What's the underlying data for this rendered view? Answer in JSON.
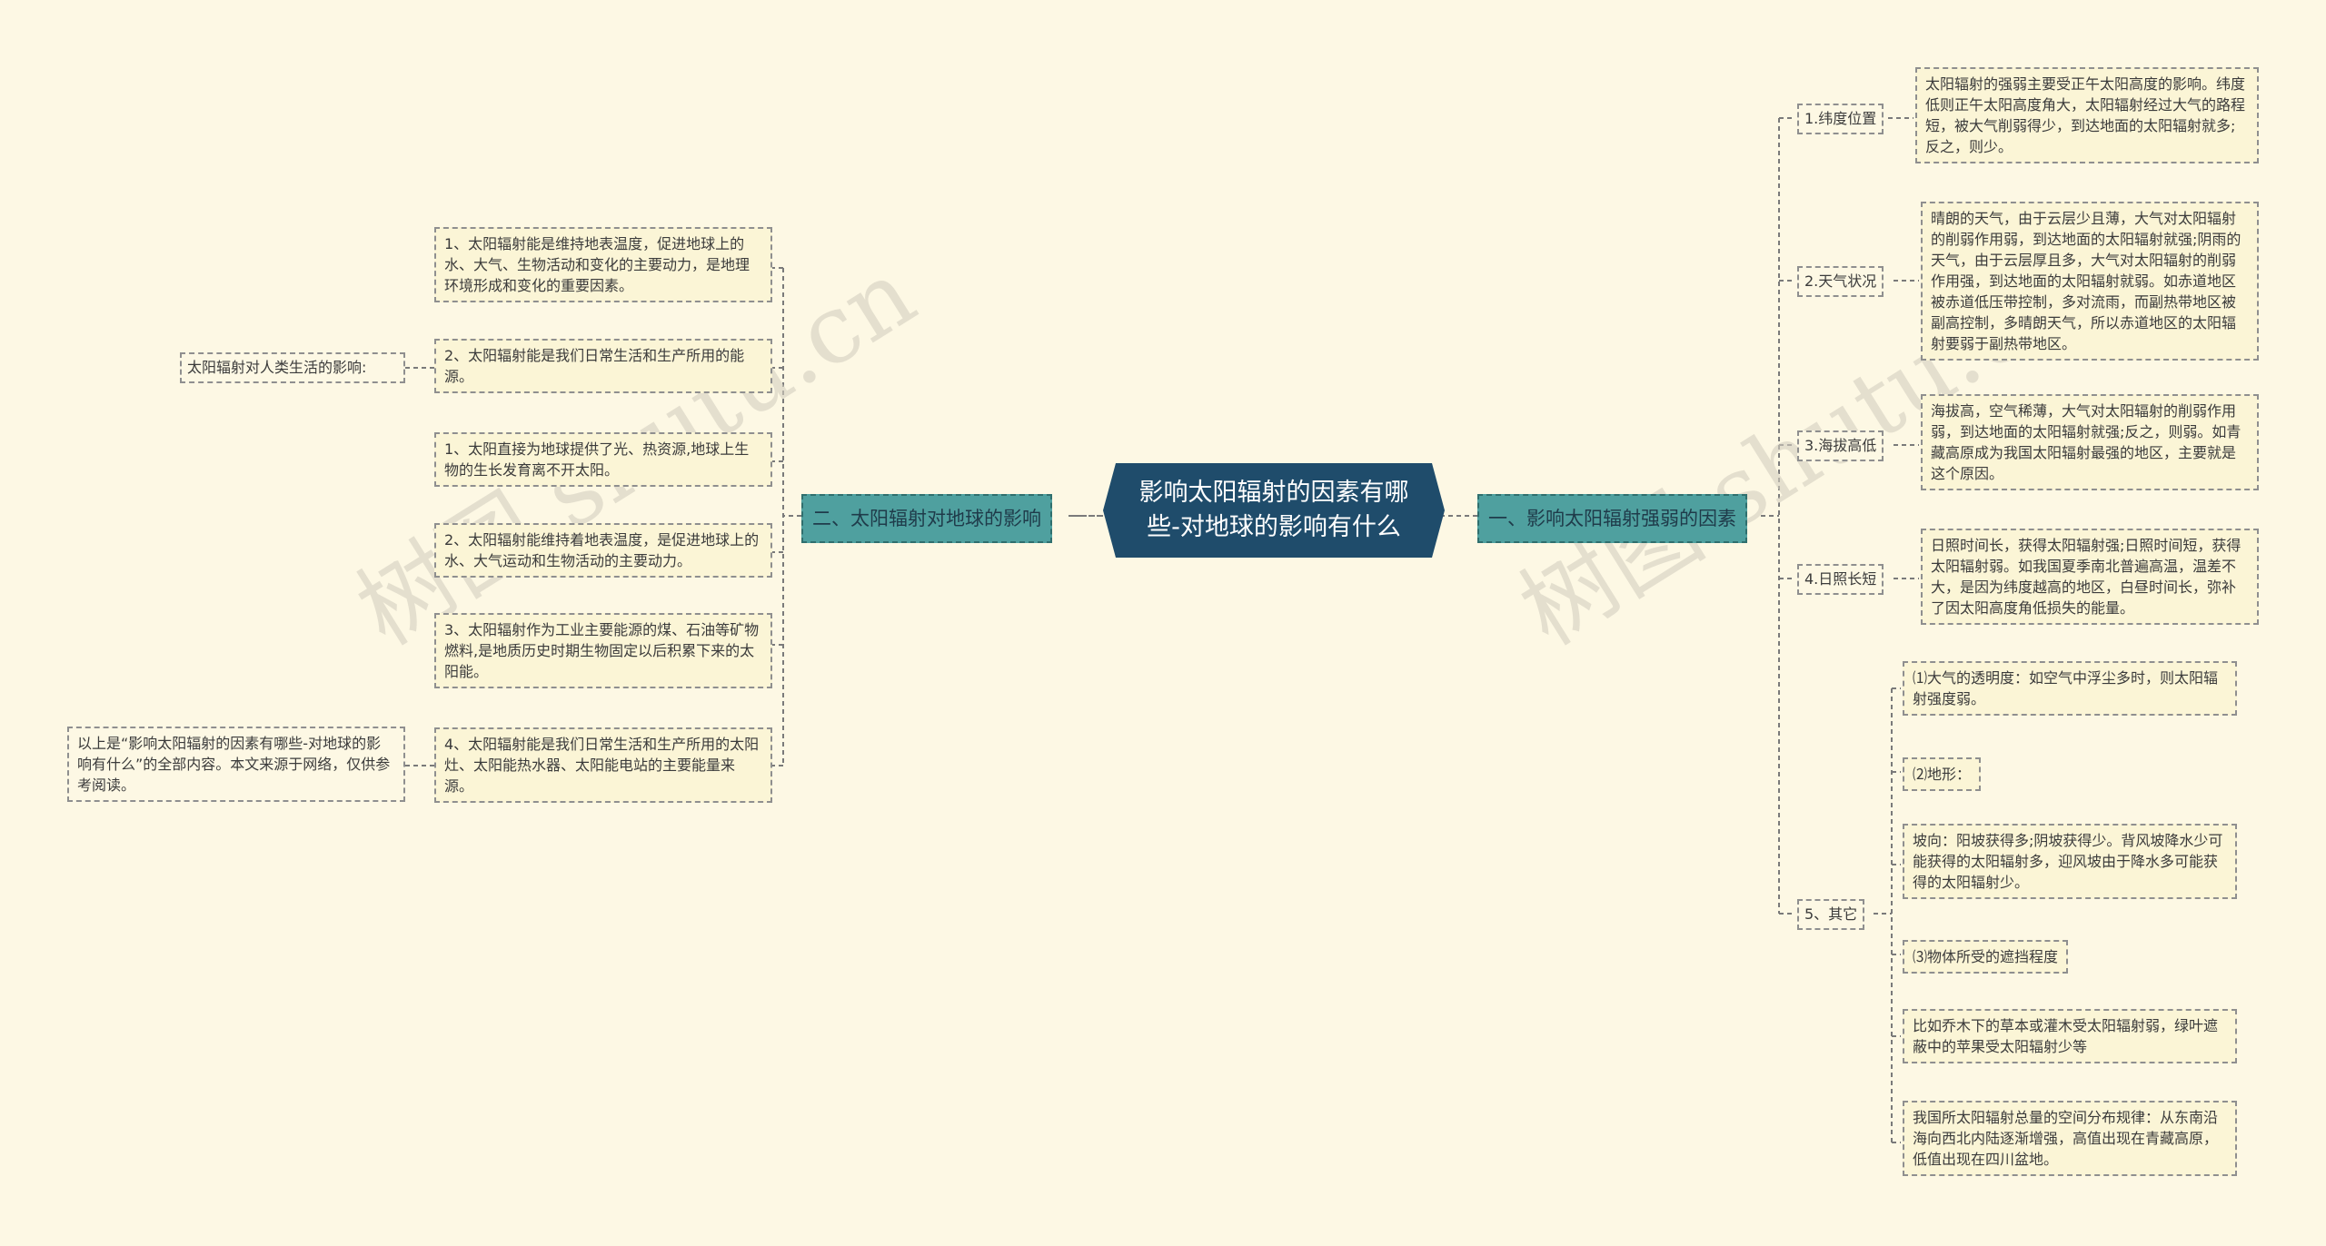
{
  "center": {
    "title": "影响太阳辐射的因素有哪些-对地球的影响有什么"
  },
  "watermark": "树图 shutu.cn",
  "right_branch": {
    "label": "一、影响太阳辐射强弱的因素",
    "items": [
      {
        "label": "1.纬度位置",
        "texts": [
          "太阳辐射的强弱主要受正午太阳高度的影响。纬度低则正午太阳高度角大，太阳辐射经过大气的路程短，被大气削弱得少，到达地面的太阳辐射就多;反之，则少。"
        ]
      },
      {
        "label": "2.天气状况",
        "texts": [
          "晴朗的天气，由于云层少且薄，大气对太阳辐射的削弱作用弱，到达地面的太阳辐射就强;阴雨的天气，由于云层厚且多，大气对太阳辐射的削弱作用强，到达地面的太阳辐射就弱。如赤道地区被赤道低压带控制，多对流雨，而副热带地区被副高控制，多晴朗天气，所以赤道地区的太阳辐射要弱于副热带地区。"
        ]
      },
      {
        "label": "3.海拔高低",
        "texts": [
          "海拔高，空气稀薄，大气对太阳辐射的削弱作用弱，到达地面的太阳辐射就强;反之，则弱。如青藏高原成为我国太阳辐射最强的地区，主要就是这个原因。"
        ]
      },
      {
        "label": "4.日照长短",
        "texts": [
          "日照时间长，获得太阳辐射强;日照时间短，获得太阳辐射弱。如我国夏季南北普遍高温，温差不大，是因为纬度越高的地区，白昼时间长，弥补了因太阳高度角低损失的能量。"
        ]
      },
      {
        "label": "5、其它",
        "texts": [
          "⑴大气的透明度：如空气中浮尘多时，则太阳辐射强度弱。",
          "⑵地形：",
          "坡向：阳坡获得多;阴坡获得少。背风坡降水少可能获得的太阳辐射多，迎风坡由于降水多可能获得的太阳辐射少。",
          "⑶物体所受的遮挡程度",
          "比如乔木下的草本或灌木受太阳辐射弱，绿叶遮蔽中的苹果受太阳辐射少等",
          "我国所太阳辐射总量的空间分布规律：从东南沿海向西北内陆逐渐增强，高值出现在青藏高原，低值出现在四川盆地。"
        ]
      }
    ]
  },
  "left_branch": {
    "label": "二、太阳辐射对地球的影响",
    "items": [
      "1、太阳辐射能是维持地表温度，促进地球上的水、大气、生物活动和变化的主要动力，是地理环境形成和变化的重要因素。",
      "2、太阳辐射能是我们日常生活和生产所用的能源。",
      "1、太阳直接为地球提供了光、热资源,地球上生物的生长发育离不开太阳。",
      "2、太阳辐射能维持着地表温度，是促进地球上的水、大气运动和生物活动的主要动力。",
      "3、太阳辐射作为工业主要能源的煤、石油等矿物燃料,是地质历史时期生物固定以后积累下来的太阳能。",
      "4、太阳辐射能是我们日常生活和生产所用的太阳灶、太阳能热水器、太阳能电站的主要能量来源。"
    ],
    "human_life_label": "太阳辐射对人类生活的影响:",
    "footer_note": "以上是“影响太阳辐射的因素有哪些-对地球的影响有什么”的全部内容。本文来源于网络，仅供参考阅读。"
  }
}
